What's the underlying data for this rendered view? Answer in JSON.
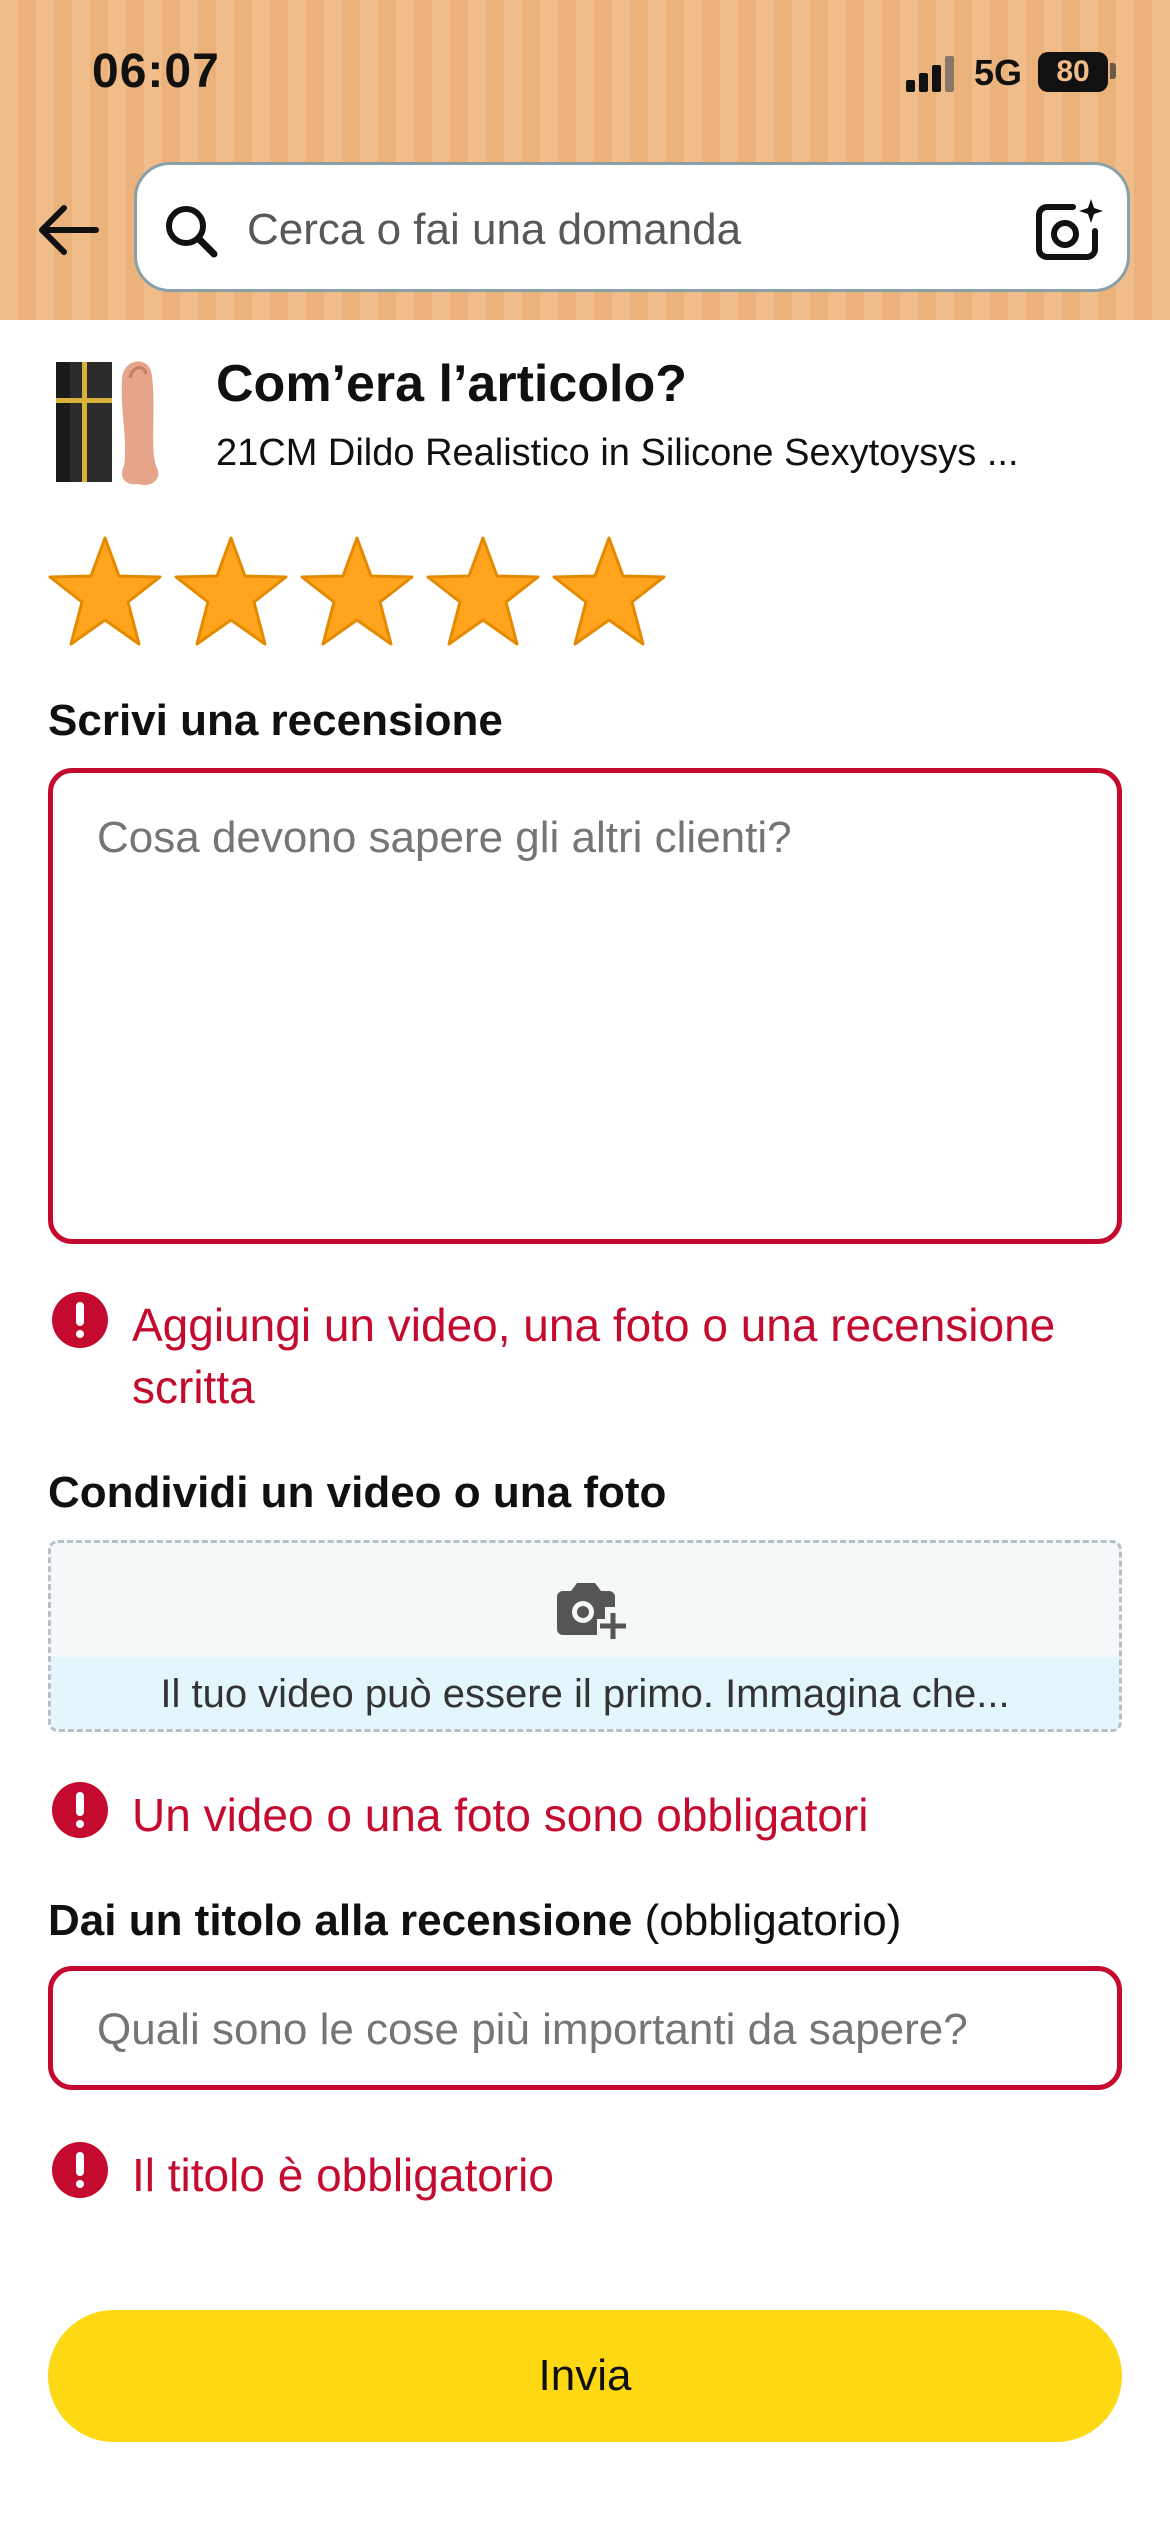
{
  "status_bar": {
    "time": "06:07",
    "network": "5G",
    "battery": "80"
  },
  "search": {
    "placeholder": "Cerca o fai una domanda"
  },
  "product": {
    "question": "Com’era l’articolo?",
    "name": "21CM Dildo Realistico in Silicone Sexytoysys ..."
  },
  "rating": {
    "stars_filled": 5,
    "max_stars": 5
  },
  "review": {
    "label": "Scrivi una recensione",
    "placeholder": "Cosa devono sapere gli altri clienti?",
    "error": "Aggiungi un video, una foto o una recensione scritta"
  },
  "media": {
    "label": "Condividi un video o una foto",
    "hint": "Il tuo video può essere il primo. Immagina che...",
    "error": "Un video o una foto sono obbligatori"
  },
  "title_field": {
    "label": "Dai un titolo alla recensione",
    "required_note": "(obbligatorio)",
    "placeholder": "Quali sono le cose più importanti da sapere?",
    "error": "Il titolo è obbligatorio"
  },
  "submit": {
    "label": "Invia"
  },
  "colors": {
    "header_bg": "#f0bc8a",
    "error": "#c40a2f",
    "star": "#ffa41c",
    "submit_bg": "#ffd814"
  }
}
